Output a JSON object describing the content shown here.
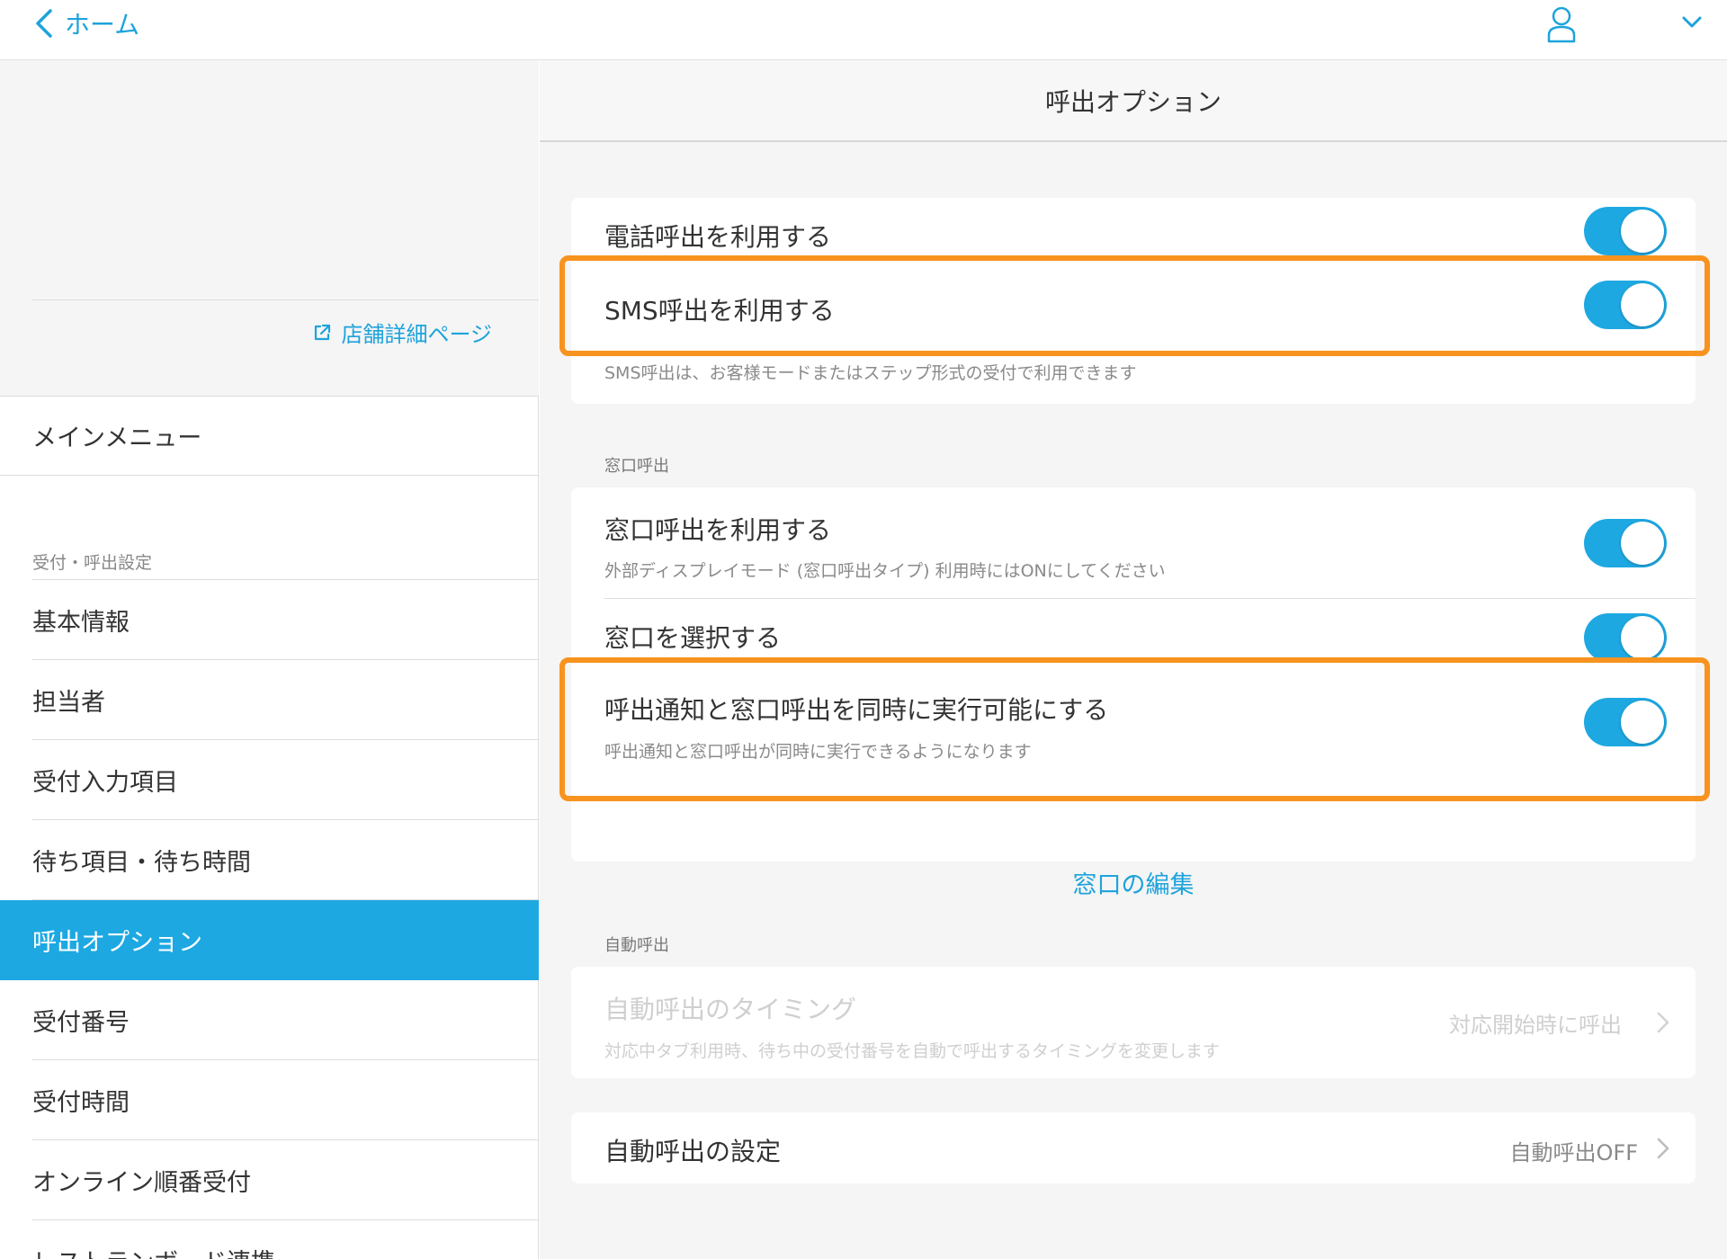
{
  "topbar": {
    "back_label": "ホーム",
    "icons": {
      "back": "chevron-left-icon",
      "user": "user-icon",
      "menu": "chevron-down-icon"
    }
  },
  "sidebar": {
    "store_link": "店舗詳細ページ",
    "main_menu": "メインメニュー",
    "section_label": "受付・呼出設定",
    "items": [
      {
        "label": "基本情報",
        "active": false
      },
      {
        "label": "担当者",
        "active": false
      },
      {
        "label": "受付入力項目",
        "active": false
      },
      {
        "label": "待ち項目・待ち時間",
        "active": false
      },
      {
        "label": "呼出オプション",
        "active": true
      },
      {
        "label": "受付番号",
        "active": false
      },
      {
        "label": "受付時間",
        "active": false
      },
      {
        "label": "オンライン順番受付",
        "active": false
      },
      {
        "label": "レストランボード連携",
        "active": false
      }
    ]
  },
  "main": {
    "title": "呼出オプション",
    "call_card": {
      "phone_call": {
        "label": "電話呼出を利用する",
        "on": true
      },
      "sms_call": {
        "label": "SMS呼出を利用する",
        "on": true
      }
    },
    "sms_note": "SMS呼出は、お客様モードまたはステップ形式の受付で利用できます",
    "window_section_label": "窓口呼出",
    "window_card": {
      "use_window": {
        "label": "窓口呼出を利用する",
        "sub": "外部ディスプレイモード (窓口呼出タイプ) 利用時にはONにしてください",
        "on": true
      },
      "select_window": {
        "label": "窓口を選択する",
        "on": true
      },
      "simultaneous": {
        "label": "呼出通知と窓口呼出を同時に実行可能にする",
        "sub": "呼出通知と窓口呼出が同時に実行できるようになります",
        "on": true
      },
      "edit_link": "窓口の編集"
    },
    "auto_section_label": "自動呼出",
    "auto_timing": {
      "label": "自動呼出のタイミング",
      "sub": "対応中タブ利用時、待ち中の受付番号を自動で呼出するタイミングを変更します",
      "value": "対応開始時に呼出",
      "disabled": true
    },
    "auto_settings": {
      "label": "自動呼出の設定",
      "value": "自動呼出OFF"
    }
  },
  "colors": {
    "accent": "#1ea8e2",
    "highlight": "#f7931e",
    "link": "#1ea3dc"
  }
}
